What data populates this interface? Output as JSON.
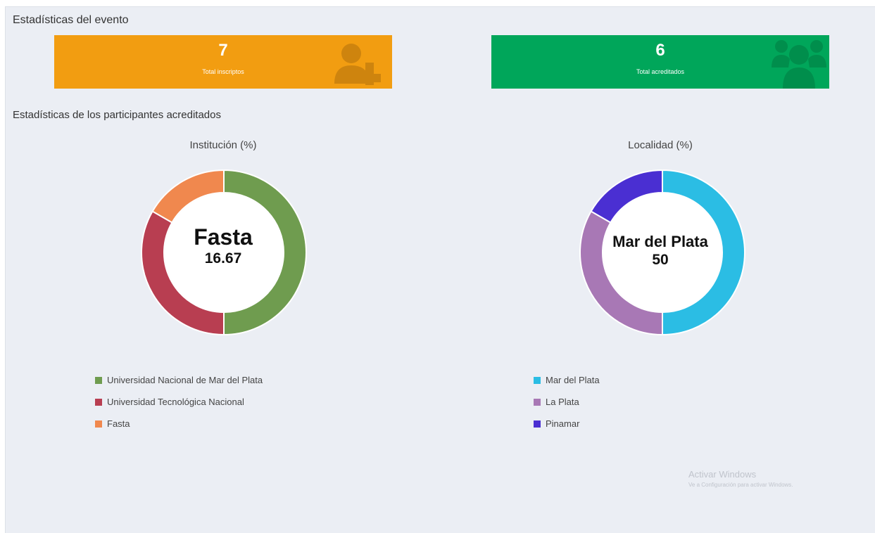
{
  "sections": {
    "event_stats_title": "Estadísticas del evento",
    "participants_stats_title": "Estadísticas de los participantes acreditados"
  },
  "cards": [
    {
      "value": "7",
      "label": "Total inscriptos",
      "color": "#f29d11",
      "icon": "user-plus-icon"
    },
    {
      "value": "6",
      "label": "Total acreditados",
      "color": "#00a65a",
      "icon": "users-icon"
    }
  ],
  "chart_data": [
    {
      "type": "pie",
      "title": "Institución (%)",
      "center_label": {
        "name": "Fasta",
        "value": "16.67"
      },
      "categories": [
        "Universidad Nacional de Mar del Plata",
        "Universidad Tecnológica Nacional",
        "Fasta"
      ],
      "values": [
        50,
        33.33,
        16.67
      ],
      "colors": [
        "#6f9c4f",
        "#b83e51",
        "#f0884e"
      ],
      "legend": "bottom"
    },
    {
      "type": "pie",
      "title": "Localidad (%)",
      "center_label": {
        "name": "Mar del Plata",
        "value": "50"
      },
      "categories": [
        "Mar del Plata",
        "La Plata",
        "Pinamar"
      ],
      "values": [
        50,
        33.33,
        16.67
      ],
      "colors": [
        "#2bbde4",
        "#a878b5",
        "#4a2fd2"
      ],
      "legend": "bottom"
    }
  ],
  "watermark": {
    "line1": "Activar Windows",
    "line2": "Ve a Configuración para activar Windows."
  }
}
